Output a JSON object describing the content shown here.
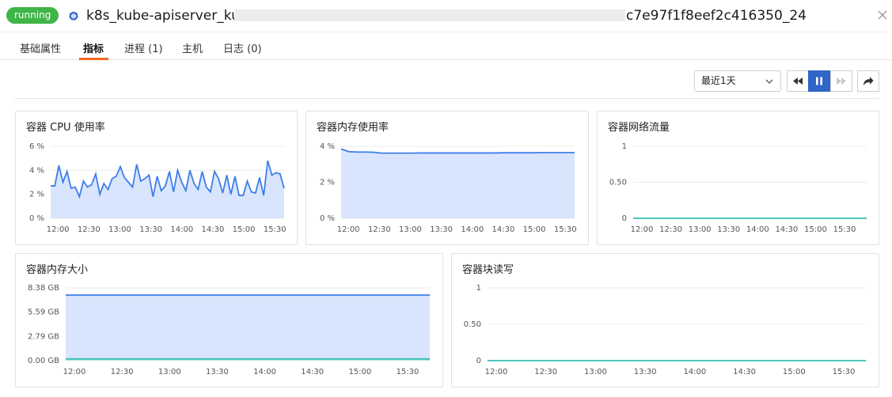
{
  "header": {
    "status": "running",
    "title_start": "k8s_kube-apiserver_kube",
    "title_end": "c7e97f1f8eef2c416350_24"
  },
  "tabs": [
    {
      "label": "基础属性"
    },
    {
      "label": "指标"
    },
    {
      "label": "进程 (1)"
    },
    {
      "label": "主机"
    },
    {
      "label": "日志 (0)"
    }
  ],
  "toolbar": {
    "range": "最近1天"
  },
  "colors": {
    "status_green": "#3fb548",
    "accent_blue": "#2f66c8",
    "tab_underline": "#f06a24",
    "line_blue": "#3d7ee8",
    "area_fill": "#d9e5fc",
    "line_teal": "#36bfb2"
  },
  "panels": {
    "cpu": {
      "title": "容器 CPU 使用率",
      "y_ticks": [
        "6 %",
        "4 %",
        "2 %",
        "0 %"
      ],
      "x_ticks": [
        "12:00",
        "12:30",
        "13:00",
        "13:30",
        "14:00",
        "14:30",
        "15:00",
        "15:30"
      ]
    },
    "mem_pct": {
      "title": "容器内存使用率",
      "y_ticks": [
        "4 %",
        "2 %",
        "0 %"
      ],
      "x_ticks": [
        "12:00",
        "12:30",
        "13:00",
        "13:30",
        "14:00",
        "14:30",
        "15:00",
        "15:30"
      ]
    },
    "net": {
      "title": "容器网络流量",
      "y_ticks": [
        "1",
        "0.50",
        "0"
      ],
      "x_ticks": [
        "12:00",
        "12:30",
        "13:00",
        "13:30",
        "14:00",
        "14:30",
        "15:00",
        "15:30"
      ]
    },
    "mem_size": {
      "title": "容器内存大小",
      "y_ticks": [
        "8.38 GB",
        "5.59 GB",
        "2.79 GB",
        "0.00 GB"
      ],
      "x_ticks": [
        "12:00",
        "12:30",
        "13:00",
        "13:30",
        "14:00",
        "14:30",
        "15:00",
        "15:30"
      ]
    },
    "block_io": {
      "title": "容器块读写",
      "y_ticks": [
        "1",
        "0.50",
        "0"
      ],
      "x_ticks": [
        "12:00",
        "12:30",
        "13:00",
        "13:30",
        "14:00",
        "14:30",
        "15:00",
        "15:30"
      ]
    }
  },
  "chart_data": [
    {
      "type": "area",
      "title": "容器 CPU 使用率",
      "ylim": [
        0,
        6
      ],
      "x_start": "11:53",
      "x_end": "15:39",
      "series": [
        {
          "values": [
            2.7,
            2.7,
            4.4,
            3.0,
            3.9,
            2.5,
            2.6,
            1.8,
            3.1,
            2.6,
            2.8,
            3.7,
            2.0,
            2.9,
            2.4,
            3.3,
            3.5,
            4.3,
            3.4,
            3.0,
            2.6,
            4.5,
            3.1,
            3.3,
            3.6,
            1.8,
            3.5,
            2.3,
            2.7,
            3.9,
            2.2,
            4.0,
            3.0,
            2.3,
            4.0,
            2.9,
            2.4,
            3.9,
            2.6,
            2.2,
            3.9,
            3.3,
            2.1,
            3.6,
            2.0,
            3.5,
            1.9,
            1.9,
            3.1,
            2.2,
            2.1,
            3.4,
            1.9,
            4.8,
            3.6,
            3.8,
            3.7,
            2.5
          ]
        }
      ]
    },
    {
      "type": "area",
      "title": "容器内存使用率",
      "ylim": [
        0,
        4
      ],
      "x_start": "11:53",
      "x_end": "15:39",
      "series": [
        {
          "values": [
            3.85,
            3.7,
            3.68,
            3.68,
            3.67,
            3.62,
            3.62,
            3.62,
            3.62,
            3.62,
            3.63,
            3.63,
            3.63,
            3.63,
            3.63,
            3.63,
            3.63,
            3.63,
            3.63,
            3.63,
            3.64,
            3.64,
            3.64,
            3.64,
            3.64,
            3.65,
            3.65,
            3.65,
            3.65,
            3.65
          ]
        }
      ]
    },
    {
      "type": "line",
      "title": "容器网络流量",
      "ylim": [
        0,
        1
      ],
      "series": [
        {
          "values": [
            0,
            0
          ]
        }
      ]
    },
    {
      "type": "area",
      "title": "容器内存大小",
      "ylim": [
        0,
        8.38
      ],
      "series": [
        {
          "values": [
            7.55,
            7.55
          ]
        },
        {
          "values": [
            0.2,
            0.2
          ]
        }
      ]
    },
    {
      "type": "line",
      "title": "容器块读写",
      "ylim": [
        0,
        1
      ],
      "series": [
        {
          "values": [
            0,
            0
          ]
        }
      ]
    }
  ]
}
